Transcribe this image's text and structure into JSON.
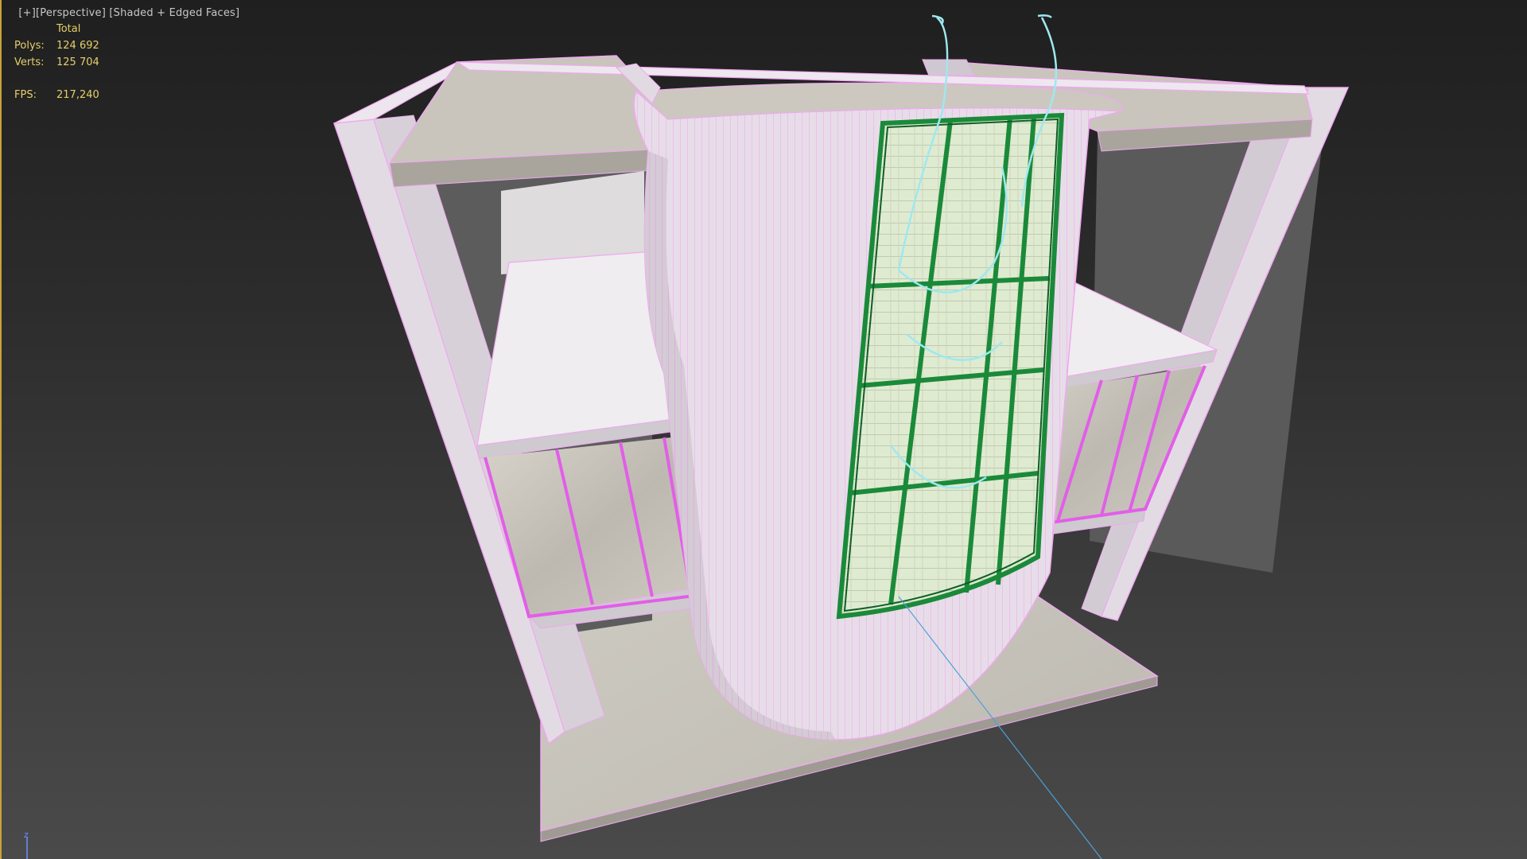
{
  "viewport": {
    "label_parts": [
      "[+]",
      "[Perspective]",
      "[Shaded + Edged Faces]"
    ],
    "background_top": "#1f1f1f",
    "background_bottom": "#4a4a4a",
    "active_border_color": "#c8a23a"
  },
  "statistics": {
    "header": "Total",
    "polys_label": "Polys:",
    "polys_value": "124 692",
    "verts_label": "Verts:",
    "verts_value": "125 704",
    "fps_label": "FPS:",
    "fps_value": "217,240",
    "text_color": "#e6cf6a"
  },
  "scene": {
    "description_icon": "building-model",
    "wall_color": "#e6dfe6",
    "wall_shade_color": "#c9c2c9",
    "edge_color": "#f0a8f0",
    "floor_color": "#c8c6bf",
    "window_frame_color": "#1a8a3a",
    "stair_color": "#f0ebc0",
    "railing_color": "#9fe8f0",
    "axis_line_color": "#4ea0d8"
  },
  "axis_gizmo": {
    "z_label": "z",
    "z_color": "#6c8fff"
  }
}
